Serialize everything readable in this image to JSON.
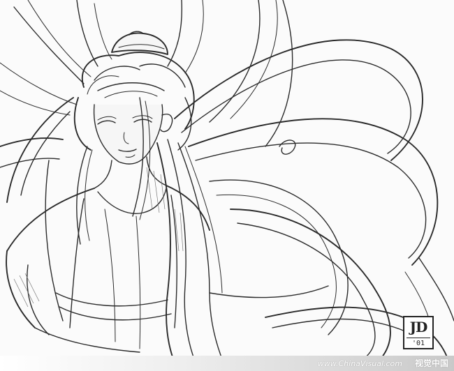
{
  "artwork": {
    "subject": "pencil line drawing of a figure with long flowing hair",
    "ink_color": "#2a2a2a",
    "paper_color": "#fbfbfb"
  },
  "signature": {
    "initials": "JD",
    "year": "'01"
  },
  "watermark": {
    "url": "www.ChinaVisual.com",
    "brand": "视觉中国"
  }
}
